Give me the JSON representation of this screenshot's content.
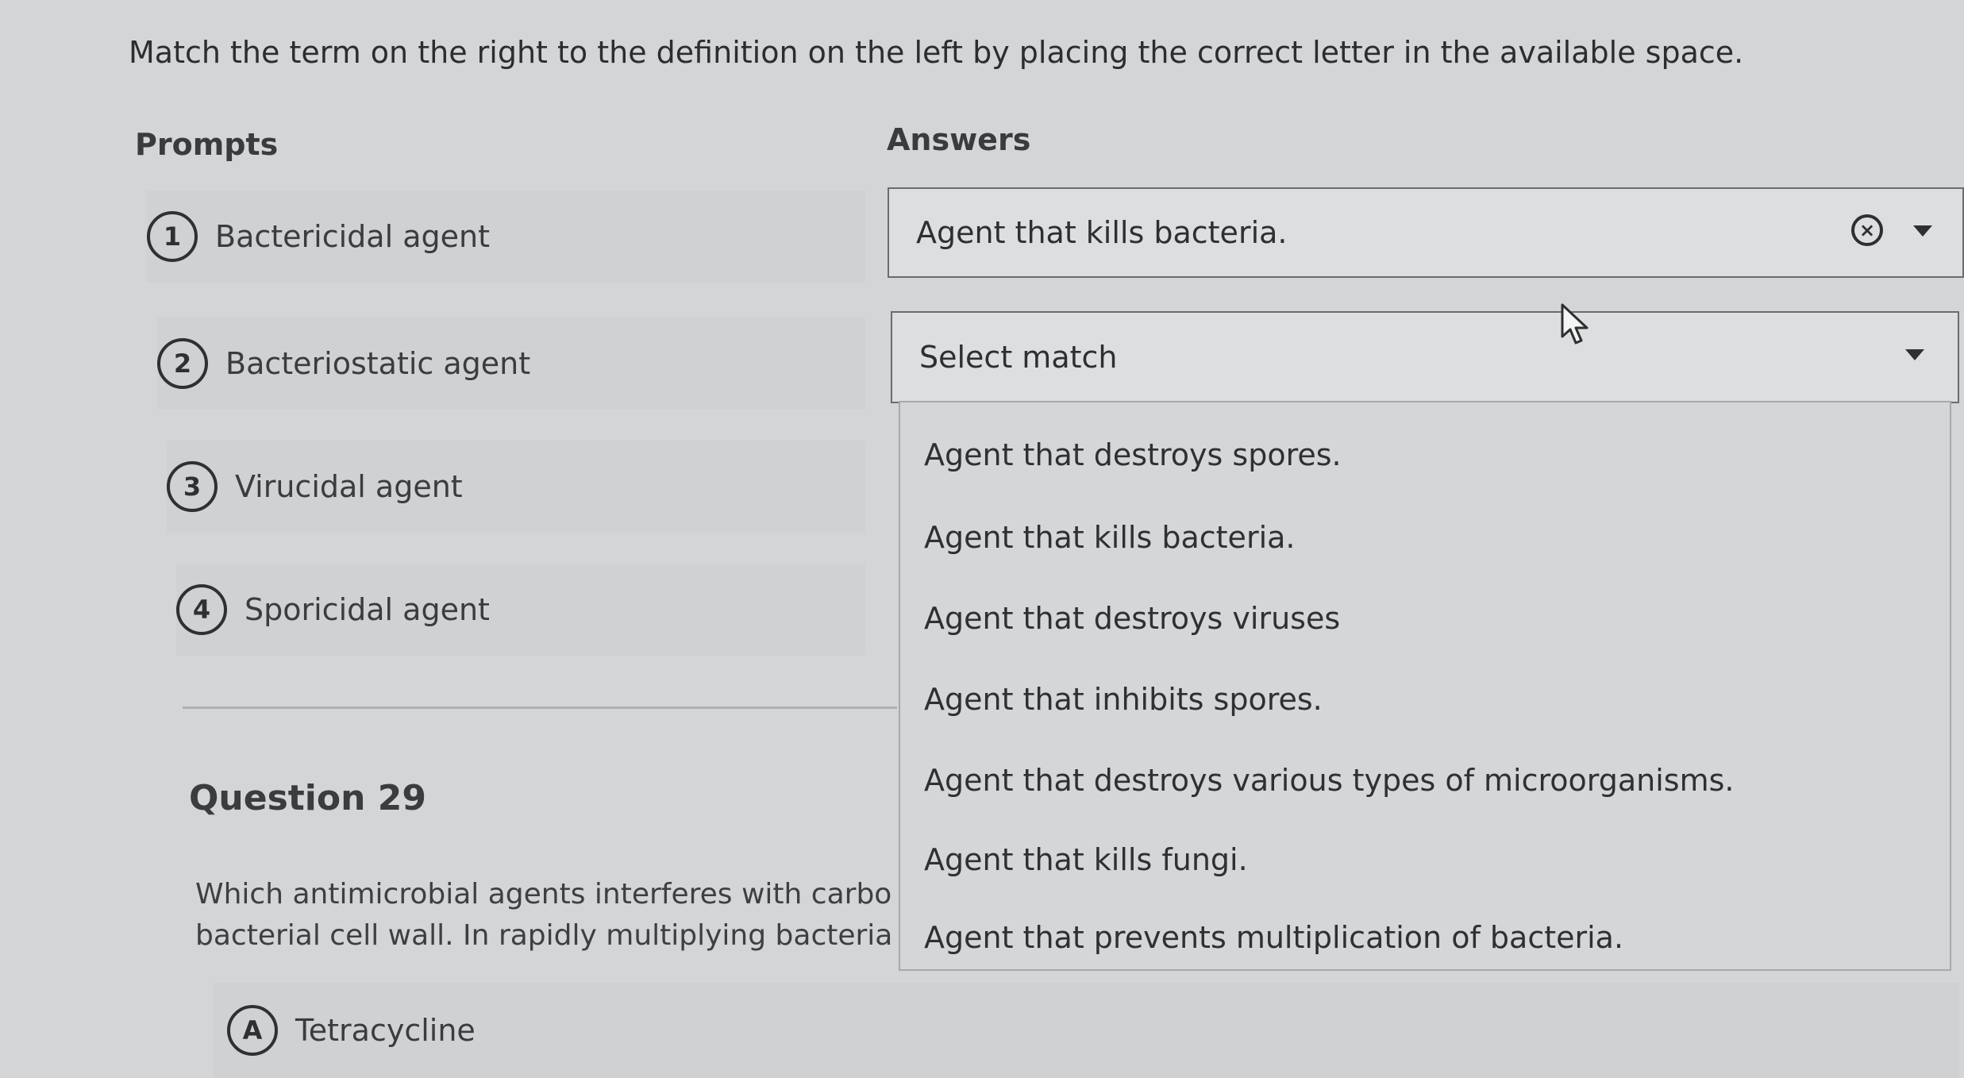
{
  "instructions": "Match the term on the right to the definition on the left by placing the correct letter in the available space.",
  "headers": {
    "prompts": "Prompts",
    "answers": "Answers"
  },
  "prompts": [
    {
      "number": "1",
      "label": "Bactericidal agent"
    },
    {
      "number": "2",
      "label": "Bacteriostatic agent"
    },
    {
      "number": "3",
      "label": "Virucidal agent"
    },
    {
      "number": "4",
      "label": "Sporicidal agent"
    }
  ],
  "answer_selects": [
    {
      "value": "Agent that kills bacteria.",
      "clear_icon": "clear-circle-x-icon",
      "caret_icon": "caret-down-icon"
    },
    {
      "placeholder": "Select match",
      "caret_icon": "caret-down-icon",
      "state": "open"
    }
  ],
  "dropdown_options": [
    "Agent that destroys spores.",
    "Agent that kills bacteria.",
    "Agent that destroys viruses",
    "Agent that inhibits spores.",
    "Agent that destroys various types of microorganisms.",
    "Agent that kills fungi.",
    "Agent that prevents multiplication of bacteria."
  ],
  "question": {
    "title": "Question 29",
    "line1": "Which antimicrobial agents interferes with carbohydra",
    "line2": "bacterial cell wall. In rapidly multiplying bacteria this w",
    "choices": [
      {
        "letter": "A",
        "label": "Tetracycline"
      }
    ]
  },
  "icons": {
    "cursor": "mouse-pointer-icon"
  },
  "colors": {
    "background": "#d3d5d6",
    "text": "#2e2f30",
    "border": "#6a6c6e"
  }
}
